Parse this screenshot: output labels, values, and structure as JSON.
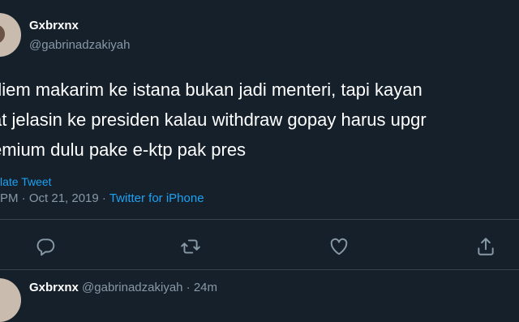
{
  "tweet": {
    "author_name": "Gxbrxnx",
    "author_handle": "@gabrinadzakiyah",
    "text_lines": [
      "diem makarim ke istana bukan jadi menteri, tapi kayan",
      "at jelasin ke presiden kalau withdraw gopay harus upgr",
      "emium dulu pake e-ktp pak pres"
    ],
    "translate_label": "late Tweet",
    "time": "PM",
    "date": "Oct 21, 2019",
    "source": "Twitter for iPhone"
  },
  "actions": {
    "icons": [
      "reply-icon",
      "retweet-icon",
      "like-icon",
      "share-icon"
    ]
  },
  "reply": {
    "author_name": "Gxbrxnx",
    "author_handle": "@gabrinadzakiyah",
    "time_ago": "24m"
  },
  "colors": {
    "background": "#15202b",
    "accent": "#1da1f2",
    "muted": "#8899a6",
    "divider": "#38444d"
  }
}
